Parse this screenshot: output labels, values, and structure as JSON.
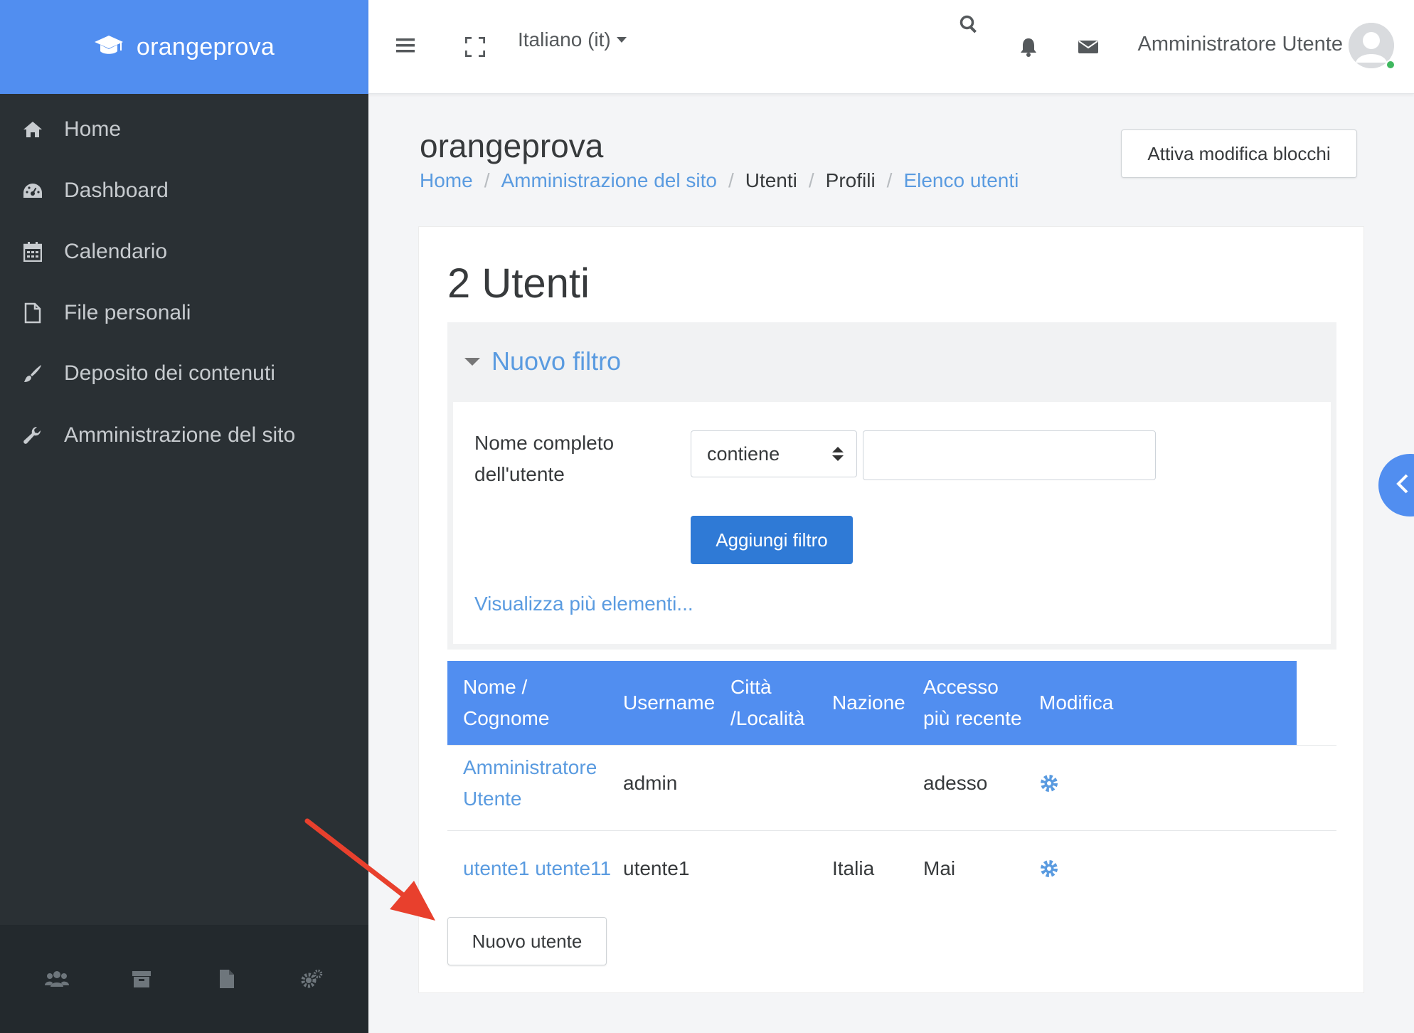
{
  "brand": {
    "name": "orangeprova",
    "icon": "graduation-cap-icon",
    "color": "#518ef0"
  },
  "sidebar": {
    "items": [
      {
        "label": "Home",
        "icon": "home-icon"
      },
      {
        "label": "Dashboard",
        "icon": "dashboard-icon"
      },
      {
        "label": "Calendario",
        "icon": "calendar-icon"
      },
      {
        "label": "File personali",
        "icon": "file-icon"
      },
      {
        "label": "Deposito dei contenuti",
        "icon": "paintbrush-icon"
      },
      {
        "label": "Amministrazione del sito",
        "icon": "wrench-icon"
      }
    ],
    "footer_icons": [
      "users-icon",
      "archive-icon",
      "document-icon",
      "cogs-icon"
    ]
  },
  "topbar": {
    "language": "Italiano (it)",
    "user_name": "Amministratore Utente",
    "icons": [
      "hamburger-icon",
      "fullscreen-icon",
      "search-icon",
      "bell-icon",
      "envelope-icon"
    ]
  },
  "page": {
    "title": "orangeprova",
    "breadcrumb": [
      {
        "label": "Home",
        "link": true
      },
      {
        "label": "Amministrazione del sito",
        "link": true
      },
      {
        "label": "Utenti",
        "link": false
      },
      {
        "label": "Profili",
        "link": false
      },
      {
        "label": "Elenco utenti",
        "link": true
      }
    ],
    "edit_blocks_button": "Attiva modifica blocchi"
  },
  "main": {
    "heading": "2 Utenti",
    "filter": {
      "title": "Nuovo filtro",
      "label_line1": "Nome completo",
      "label_line2": "dell'utente",
      "operator": "contiene",
      "value": "",
      "add_button": "Aggiungi filtro",
      "more_link": "Visualizza più elementi..."
    },
    "table": {
      "headers": {
        "name_line1": "Nome /",
        "name_line2": "Cognome",
        "username": "Username",
        "city_line1": "Città",
        "city_line2": "/Località",
        "country": "Nazione",
        "access_line1": "Accesso",
        "access_line2": "più recente",
        "edit": "Modifica"
      },
      "rows": [
        {
          "name_line1": "Amministratore",
          "name_line2": "Utente",
          "username": "admin",
          "city": "",
          "country": "",
          "last_access": "adesso",
          "edit_icon": "gear-icon"
        },
        {
          "name": "utente1 utente11",
          "username": "utente1",
          "city": "",
          "country": "Italia",
          "last_access": "Mai",
          "edit_icon": "gear-icon"
        }
      ]
    },
    "new_user_button": "Nuovo utente"
  },
  "colors": {
    "accent": "#518ef0",
    "primary_button": "#2f7ad6",
    "link": "#5a9be0",
    "sidebar_bg": "#2a3034",
    "annotation_arrow": "#e8402d"
  }
}
